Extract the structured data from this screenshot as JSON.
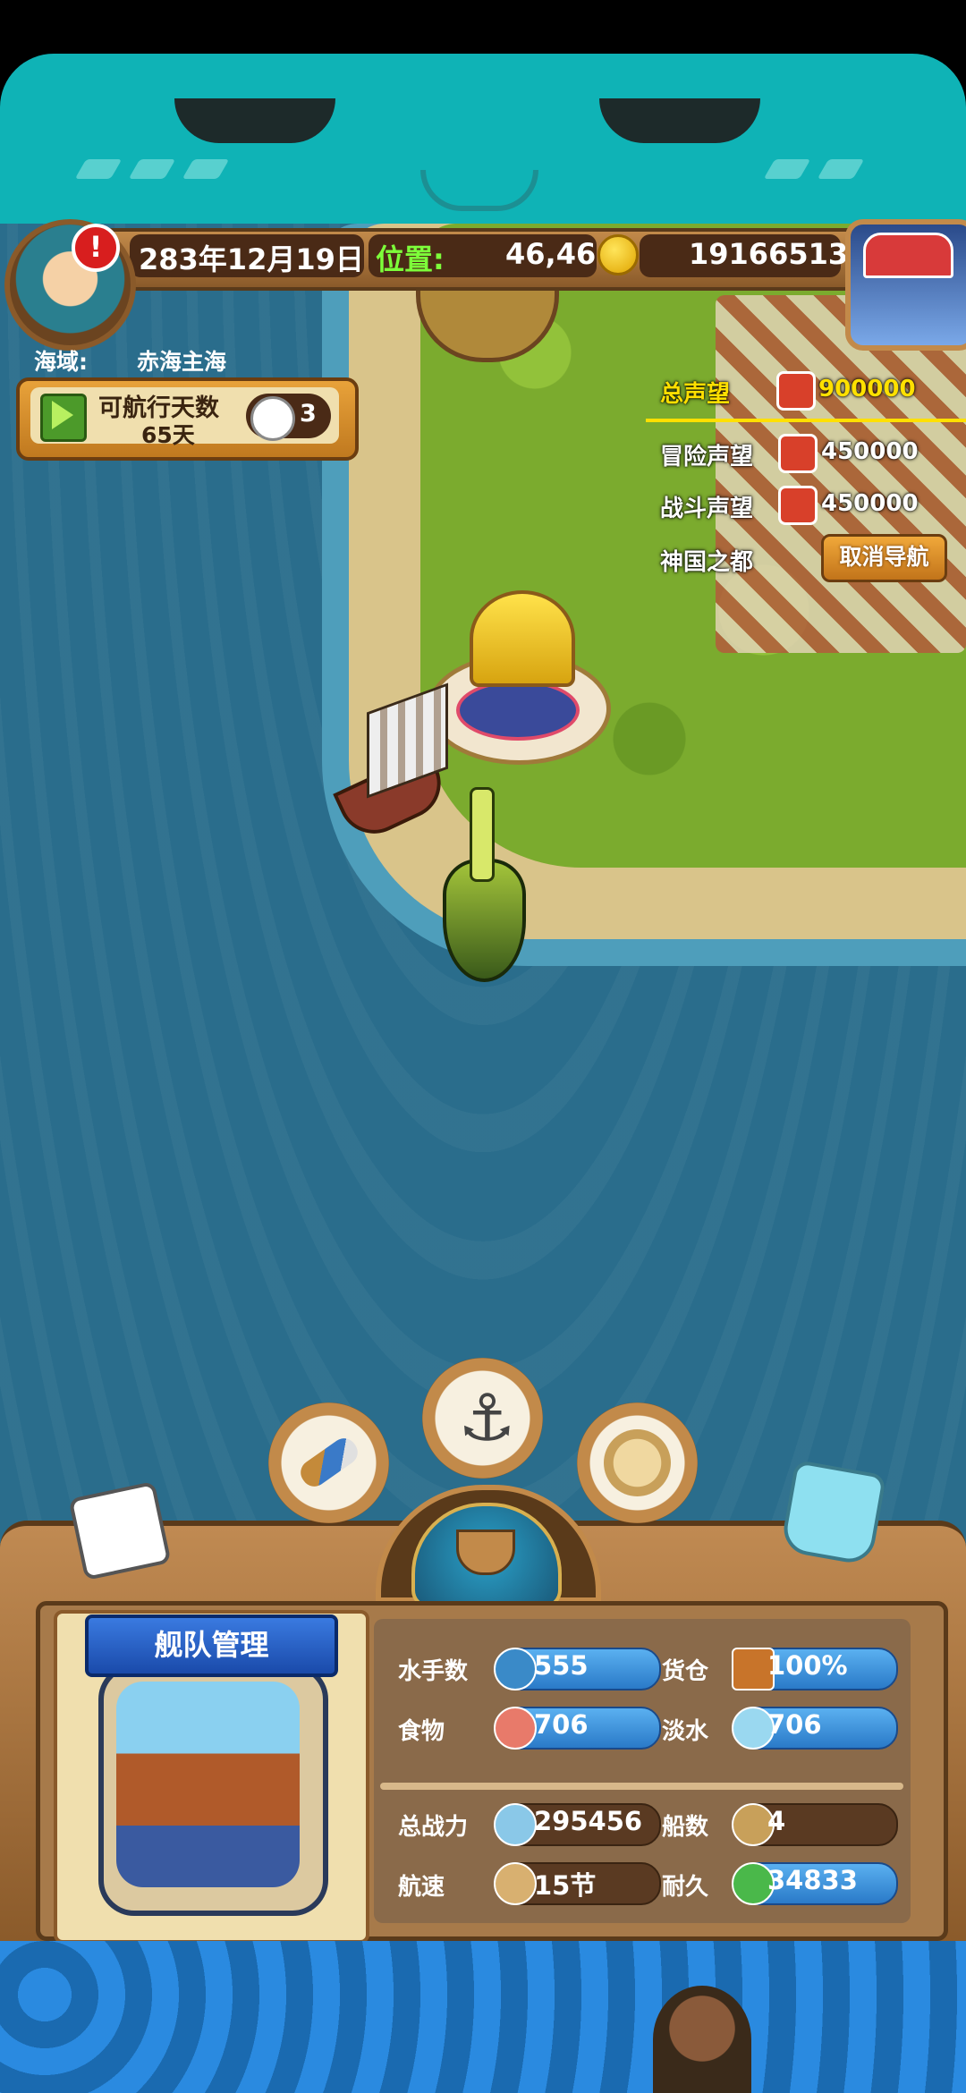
{
  "status_bar": {
    "date": "283年12月19日",
    "position_label": "位置:",
    "position_value": "46,46",
    "gold": "19166513"
  },
  "sea_area": {
    "label": "海域:",
    "value": "赤海主海"
  },
  "sailing": {
    "days_label": "可航行天数",
    "days_value": "65天",
    "fleet_count": "3"
  },
  "reputation": {
    "total_label": "总声望",
    "total_value": "900000",
    "adventure_label": "冒险声望",
    "adventure_value": "450000",
    "battle_label": "战斗声望",
    "battle_value": "450000",
    "destination": "神国之都",
    "cancel_nav": "取消导航"
  },
  "actions": {
    "icons": [
      "telescope-icon",
      "anchor-icon",
      "world-map-icon"
    ]
  },
  "fleet_panel": {
    "title": "舰队管理",
    "stats": [
      {
        "label": "水手数",
        "value": "555"
      },
      {
        "label": "货仓",
        "value": "100%"
      },
      {
        "label": "食物",
        "value": "706"
      },
      {
        "label": "淡水",
        "value": "706"
      },
      {
        "label": "总战力",
        "value": "295456"
      },
      {
        "label": "船数",
        "value": "4"
      },
      {
        "label": "航速",
        "value": "15节"
      },
      {
        "label": "耐久",
        "value": "34833"
      }
    ]
  },
  "colors": {
    "sea": "#2a6d8c",
    "banner": "#0fb3b6",
    "highlight": "#ffe000",
    "position_green": "#7dff3a"
  }
}
